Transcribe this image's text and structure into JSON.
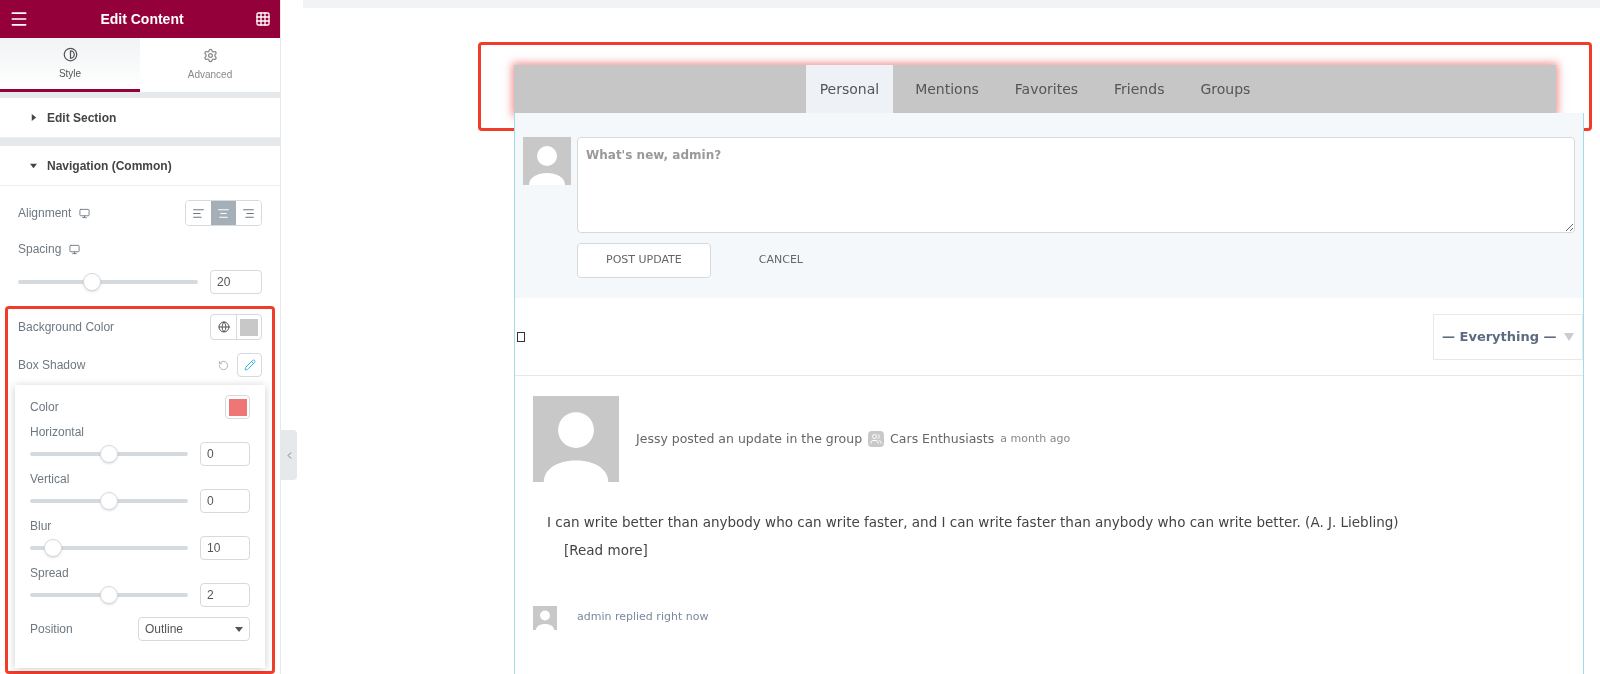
{
  "panel": {
    "title": "Edit Content",
    "tabs": [
      {
        "label": "Style",
        "kind": "style",
        "selected": true
      },
      {
        "label": "Advanced",
        "kind": "advanced",
        "selected": false
      }
    ],
    "sections": [
      {
        "title": "Edit Section",
        "expanded": false
      },
      {
        "title": "Navigation (Common)",
        "expanded": true
      }
    ],
    "alignment": {
      "label": "Alignment",
      "options": [
        {
          "kind": "left",
          "selected": false
        },
        {
          "kind": "center",
          "selected": true
        },
        {
          "kind": "right",
          "selected": false
        }
      ]
    },
    "spacing": {
      "label": "Spacing",
      "level": 0.4,
      "value": "20"
    },
    "background_color": {
      "label": "Background Color",
      "color": "#c8c8c8"
    },
    "box_shadow": {
      "label": "Box Shadow",
      "color_label": "Color",
      "color": "#ee7676",
      "sliders": [
        {
          "label": "Horizontal",
          "level": 0.5,
          "value": "0"
        },
        {
          "label": "Vertical",
          "level": 0.5,
          "value": "0"
        },
        {
          "label": "Blur",
          "level": 0.1,
          "value": "10"
        },
        {
          "label": "Spread",
          "level": 0.5,
          "value": "2"
        }
      ],
      "position": {
        "label": "Position",
        "value": "Outline"
      }
    }
  },
  "nav_tabs": [
    {
      "label": "Personal",
      "selected": true
    },
    {
      "label": "Mentions",
      "selected": false
    },
    {
      "label": "Favorites",
      "selected": false
    },
    {
      "label": "Friends",
      "selected": false
    },
    {
      "label": "Groups",
      "selected": false
    }
  ],
  "post_form": {
    "placeholder": "What's new, admin?",
    "buttons": [
      {
        "label": "POST UPDATE",
        "kind": "outlined"
      },
      {
        "label": "CANCEL",
        "kind": "plain"
      }
    ]
  },
  "filter": {
    "value": "— Everything —",
    "checked": false
  },
  "activity": {
    "action": "Jessy posted an update in the group",
    "group": "Cars Enthusiasts",
    "time": "a month ago",
    "content": "I can write better than anybody who can write faster, and I can write faster than anybody who can write better. (A. J. Liebling)",
    "read_more": "[Read more]",
    "reply": "admin replied right now"
  }
}
